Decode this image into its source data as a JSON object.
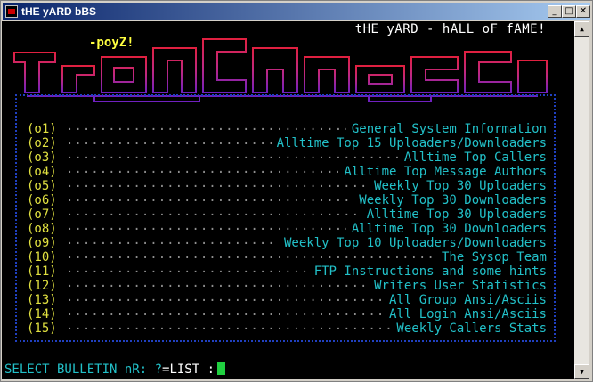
{
  "window": {
    "title": "tHE yARD bBS"
  },
  "controls": {
    "minimize": "_",
    "maximize": "□",
    "close": "✕"
  },
  "screen": {
    "header_title": "tHE yARD - hALL oF fAME!",
    "tag": "-poyZ!",
    "dots": "..........................................................................................",
    "menu": [
      {
        "num": "(o1)",
        "label": "General System Information"
      },
      {
        "num": "(o2)",
        "label": "Alltime Top 15 Uploaders/Downloaders"
      },
      {
        "num": "(o3)",
        "label": "Alltime Top Callers"
      },
      {
        "num": "(o4)",
        "label": "Alltime Top Message Authors"
      },
      {
        "num": "(o5)",
        "label": "Weekly Top 30 Uploaders"
      },
      {
        "num": "(o6)",
        "label": "Weekly Top 30 Downloaders"
      },
      {
        "num": "(o7)",
        "label": "Alltime Top 30 Uploaders"
      },
      {
        "num": "(o8)",
        "label": "Alltime Top 30 Downloaders"
      },
      {
        "num": "(o9)",
        "label": "Weekly Top 10 Uploaders/Downloaders"
      },
      {
        "num": "(10)",
        "label": "The Sysop Team"
      },
      {
        "num": "(11)",
        "label": "FTP Instructions and some hints"
      },
      {
        "num": "(12)",
        "label": "Writers User Statistics"
      },
      {
        "num": "(13)",
        "label": "All Group Ansi/Asciis"
      },
      {
        "num": "(14)",
        "label": "All Login Ansi/Asciis"
      },
      {
        "num": "(15)",
        "label": "Weekly Callers Stats"
      }
    ],
    "prompt": {
      "text": "SELECT BULLETIN nR: ?",
      "suffix": "=LIST :"
    }
  },
  "colors": {
    "titlebar": "#0a246a",
    "menu_text": "#22c0c8",
    "number": "#e0e040",
    "logo_hot": "#e02040",
    "logo_cool": "#7020c0",
    "border": "#2040c0",
    "cursor": "#20d040"
  }
}
